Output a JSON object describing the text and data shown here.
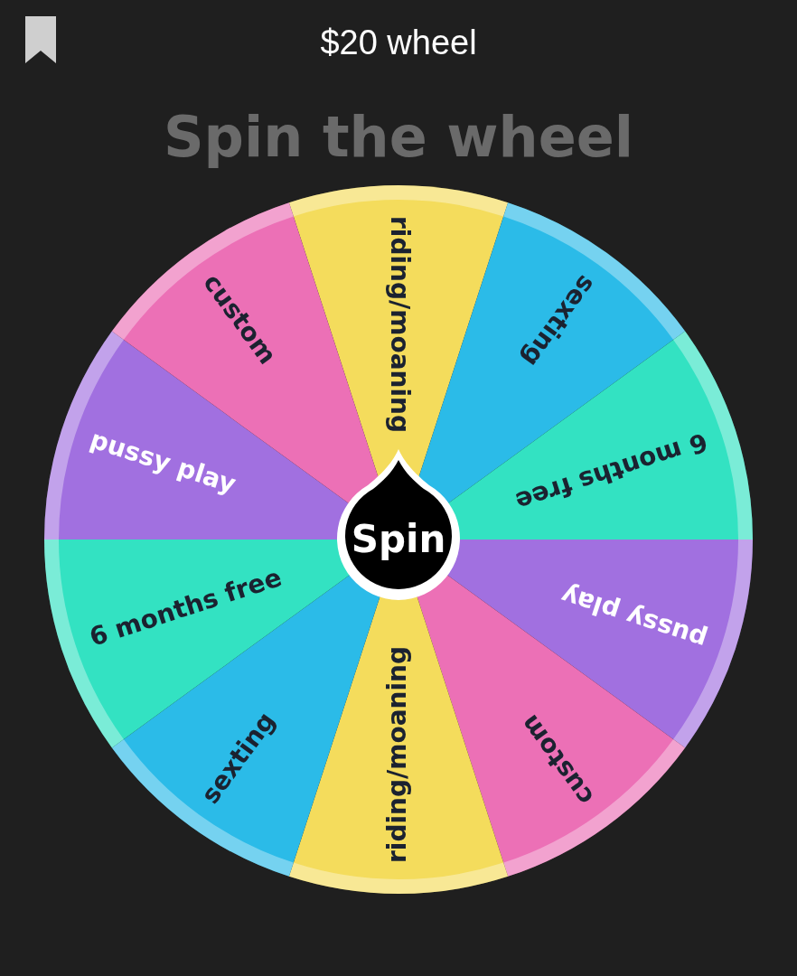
{
  "title": "$20 wheel",
  "heading": "Spin the wheel",
  "spin_button": "Spin",
  "segments": [
    {
      "label": "riding/moaning",
      "color": "#f4dc5c",
      "light_text": false
    },
    {
      "label": "sexting",
      "color": "#2bbbe8",
      "light_text": false
    },
    {
      "label": "6 months free",
      "color": "#33e2c2",
      "light_text": false
    },
    {
      "label": "pussy play",
      "color": "#a170e0",
      "light_text": true
    },
    {
      "label": "custom",
      "color": "#ec70b6",
      "light_text": false
    },
    {
      "label": "riding/moaning",
      "color": "#f4dc5c",
      "light_text": false
    },
    {
      "label": "sexting",
      "color": "#2bbbe8",
      "light_text": false
    },
    {
      "label": "6 months free",
      "color": "#33e2c2",
      "light_text": false
    },
    {
      "label": "pussy play",
      "color": "#a170e0",
      "light_text": true
    },
    {
      "label": "custom",
      "color": "#ec70b6",
      "light_text": false
    }
  ]
}
